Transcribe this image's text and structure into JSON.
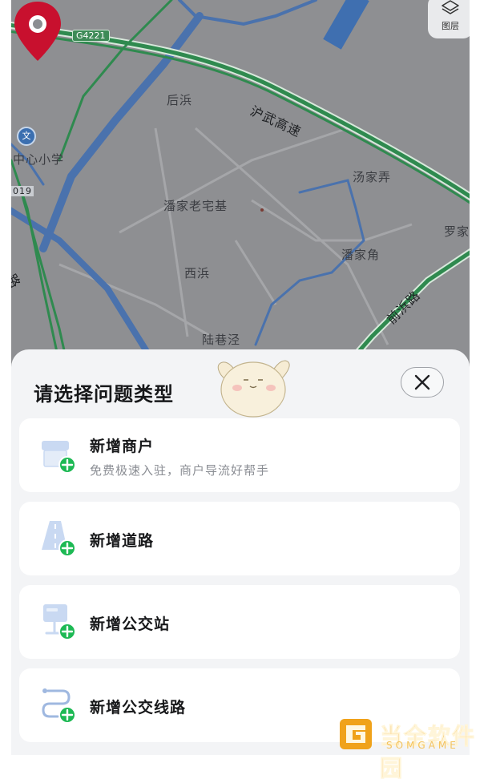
{
  "map": {
    "highway_shield": "G4221",
    "labels": {
      "houbang": "后浜",
      "huwu_expressway": "沪武高速",
      "school": "中心小学",
      "school_icon": "文",
      "tangjianong": "汤家弄",
      "panjia_cemetery": "潘家老宅基",
      "luojia": "罗家",
      "road_code": "019",
      "xibang": "西浜",
      "panjiajiao": "潘家角",
      "qianbang_road": "前浜路",
      "left_road": "心路",
      "luxiangjing": "陆巷泾"
    },
    "layers_button": {
      "label": "图层",
      "icon": "layers-icon"
    }
  },
  "sheet": {
    "title": "请选择问题类型",
    "close_icon": "close-icon",
    "options": [
      {
        "title": "新增商户",
        "subtitle": "免费极速入驻，商户导流好帮手",
        "icon": "merchant-add-icon"
      },
      {
        "title": "新增道路",
        "icon": "road-add-icon"
      },
      {
        "title": "新增公交站",
        "icon": "bus-stop-add-icon"
      },
      {
        "title": "新增公交线路",
        "icon": "bus-route-add-icon"
      }
    ]
  },
  "watermark": {
    "text": "当全软件园",
    "subtext": "SOMGAME"
  },
  "colors": {
    "map_bg": "#8e8f92",
    "highway": "#2f8a4f",
    "water": "#3f6fb0",
    "pin": "#c8102e",
    "add_badge": "#1db954",
    "sheet_bg": "#f3f4f6",
    "watermark": "#f0a21a"
  }
}
